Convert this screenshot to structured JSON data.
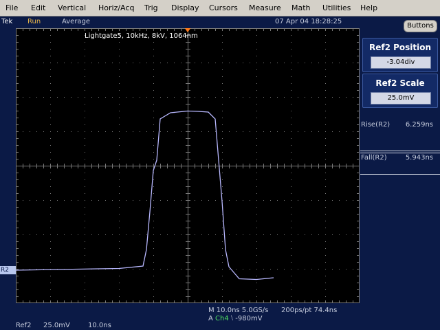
{
  "menu": [
    "File",
    "Edit",
    "Vertical",
    "Horiz/Acq",
    "Trig",
    "Display",
    "Cursors",
    "Measure",
    "Math",
    "Utilities",
    "Help"
  ],
  "status": {
    "brand": "Tek",
    "run_state": "Run",
    "acq_mode": "Average",
    "datetime": "07 Apr 04 18:28:25",
    "buttons_label": "Buttons"
  },
  "screen": {
    "trace_label": "Lightgate5, 10kHz, 8kV, 1064nm",
    "ref_marker": "R2 →",
    "trace_color": "#b8b8ff",
    "trigger_color": "#ff7a1a"
  },
  "waveform": {
    "time_per_div_ns": 10.0,
    "volts_per_div_mV": 25.0,
    "position_div": -3.04,
    "samples_ns": [
      -50,
      -20,
      -13,
      -12,
      -11,
      -10,
      -9,
      -8,
      -5,
      0,
      3,
      6,
      8,
      9,
      10,
      11,
      12,
      15,
      20,
      25
    ],
    "samples_div": [
      0.0,
      0.05,
      0.12,
      0.6,
      1.7,
      2.9,
      3.2,
      4.4,
      4.58,
      4.63,
      4.62,
      4.6,
      4.4,
      3.2,
      2.0,
      0.6,
      0.1,
      -0.25,
      -0.27,
      -0.22
    ]
  },
  "panel": {
    "position": {
      "title": "Ref2 Position",
      "value": "-3.04div"
    },
    "scale": {
      "title": "Ref2 Scale",
      "value": "25.0mV"
    },
    "measurements": [
      {
        "name": "Rise(R2)",
        "value": "6.259ns"
      },
      {
        "name": "Fall(R2)",
        "value": "5.943ns"
      }
    ]
  },
  "bottom": {
    "timebase": "M 10.0ns 5.0GS/s",
    "record": "200ps/pt 74.4ns",
    "trig_prefix": "A",
    "trig_channel": "Ch4",
    "trig_slope": "⧵",
    "trig_level": "-980mV",
    "ref_name": "Ref2",
    "ref_scale": "25.0mV",
    "ref_time": "10.0ns"
  }
}
